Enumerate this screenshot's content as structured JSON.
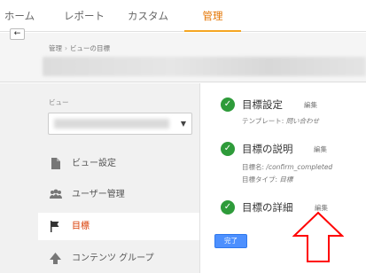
{
  "topnav": {
    "tabs": [
      {
        "label": "ホーム"
      },
      {
        "label": "レポート"
      },
      {
        "label": "カスタム"
      },
      {
        "label": "管理"
      }
    ]
  },
  "breadcrumb": {
    "root": "管理",
    "separator": "›",
    "current": "ビューの目標"
  },
  "view": {
    "label": "ビュー"
  },
  "back_icon": "←",
  "nav": {
    "items": [
      {
        "label": "ビュー設定",
        "icon": "document-icon"
      },
      {
        "label": "ユーザー管理",
        "icon": "users-icon"
      },
      {
        "label": "目標",
        "icon": "flag-icon"
      },
      {
        "label": "コンテンツ グループ",
        "icon": "content-group-icon"
      }
    ]
  },
  "steps": [
    {
      "title": "目標設定",
      "edit": "編集",
      "details": [
        {
          "label": "テンプレート: ",
          "value": "問い合わせ"
        }
      ]
    },
    {
      "title": "目標の説明",
      "edit": "編集",
      "details": [
        {
          "label": "目標名: ",
          "value": "/confirm_completed"
        },
        {
          "label": "目標タイプ: ",
          "value": "目標"
        }
      ]
    },
    {
      "title": "目標の詳細",
      "edit": "編集",
      "details": []
    }
  ],
  "done_button": "完了",
  "colors": {
    "accent": "#f5a623",
    "active_text": "#d83a00",
    "check": "#2e9b3a",
    "primary_button": "#4d90fe",
    "annotation_arrow": "#ff0000"
  }
}
